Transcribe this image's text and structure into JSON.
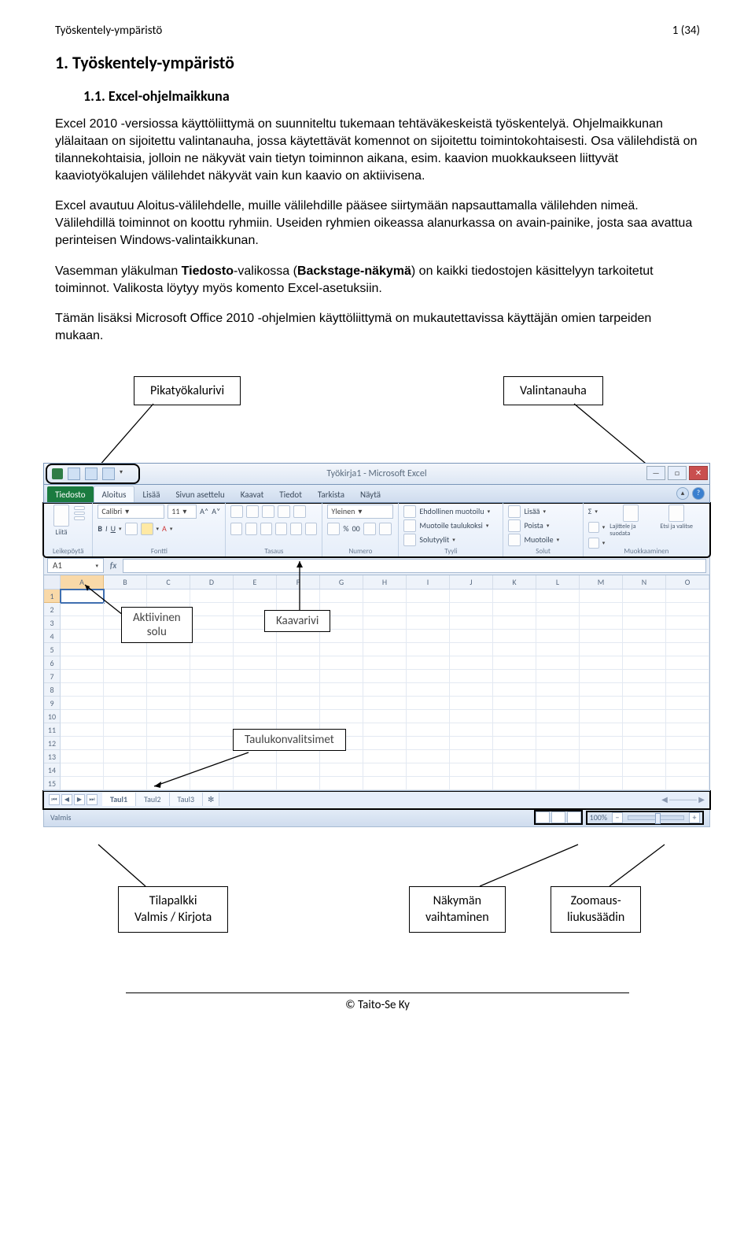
{
  "header": {
    "left": "Työskentely-ympäristö",
    "right": "1 (34)"
  },
  "title": "1. Työskentely-ympäristö",
  "subtitle": "1.1.   Excel-ohjelmaikkuna",
  "para1": "Excel 2010 -versiossa käyttöliittymä on suunniteltu tukemaan tehtäväkeskeistä työskentelyä. Ohjelmaikkunan ylälaitaan on sijoitettu valintanauha, jossa käytettävät komennot on sijoitettu toimintokohtaisesti. Osa välilehdistä on tilannekohtaisia, jolloin ne näkyvät vain tietyn toiminnon aikana, esim. kaavion muokkaukseen liittyvät kaaviotyökalujen välilehdet näkyvät vain kun kaavio on aktiivisena.",
  "para2": "Excel avautuu Aloitus-välilehdelle, muille välilehdille pääsee siirtymään napsauttamalla välilehden nimeä. Välilehdillä toiminnot on koottu ryhmiin. Useiden ryhmien oikeassa alanurkassa on avain-painike, josta saa avattua perinteisen Windows-valintaikkunan.",
  "para3_pre": "Vasemman yläkulman ",
  "para3_bold": "Tiedosto",
  "para3_mid1": "-valikossa (",
  "para3_bold2": "Backstage-näkymä",
  "para3_post": ") on kaikki tiedostojen käsittelyyn tarkoitetut toiminnot. Valikosta löytyy myös komento Excel-asetuksiin.",
  "para4": "Tämän lisäksi Microsoft Office 2010 -ohjelmien käyttöliittymä on mukautettavissa käyttäjän omien tarpeiden mukaan.",
  "ann": {
    "qat": "Pikatyökalurivi",
    "ribbon": "Valintanauha",
    "active_cell_l1": "Aktiivinen",
    "active_cell_l2": "solu",
    "formula_bar": "Kaavarivi",
    "sheet_tabs": "Taulukonvalitsimet",
    "status_l1": "Tilapalkki",
    "status_l2": "Valmis / Kirjota",
    "views_l1": "Näkymän",
    "views_l2": "vaihtaminen",
    "zoom_l1": "Zoomaus-",
    "zoom_l2": "liukusäädin"
  },
  "excel": {
    "title": "Työkirja1 - Microsoft Excel",
    "tabs": [
      "Tiedosto",
      "Aloitus",
      "Lisää",
      "Sivun asettelu",
      "Kaavat",
      "Tiedot",
      "Tarkista",
      "Näytä"
    ],
    "groups": {
      "clipboard": "Leikepöytä",
      "paste": "Liitä",
      "font": "Fontti",
      "font_name": "Calibri",
      "font_size": "11",
      "align": "Tasaus",
      "number": "Numero",
      "number_fmt": "Yleinen",
      "styles": "Tyyli",
      "cond": "Ehdollinen muotoilu",
      "table": "Muotoile taulukoksi",
      "cellstyles": "Solutyylit",
      "cells": "Solut",
      "insert": "Lisää",
      "delete": "Poista",
      "format": "Muotoile",
      "editing": "Muokkaaminen",
      "sort": "Lajittele ja suodata",
      "find": "Etsi ja valitse"
    },
    "namebox": "A1",
    "cols": [
      "A",
      "B",
      "C",
      "D",
      "E",
      "F",
      "G",
      "H",
      "I",
      "J",
      "K",
      "L",
      "M",
      "N",
      "O"
    ],
    "rows": [
      "1",
      "2",
      "3",
      "4",
      "5",
      "6",
      "7",
      "8",
      "9",
      "10",
      "11",
      "12",
      "13",
      "14",
      "15"
    ],
    "sheets": [
      "Taul1",
      "Taul2",
      "Taul3"
    ],
    "status": "Valmis",
    "zoom": "100%"
  },
  "footer": "© Taito-Se Ky"
}
